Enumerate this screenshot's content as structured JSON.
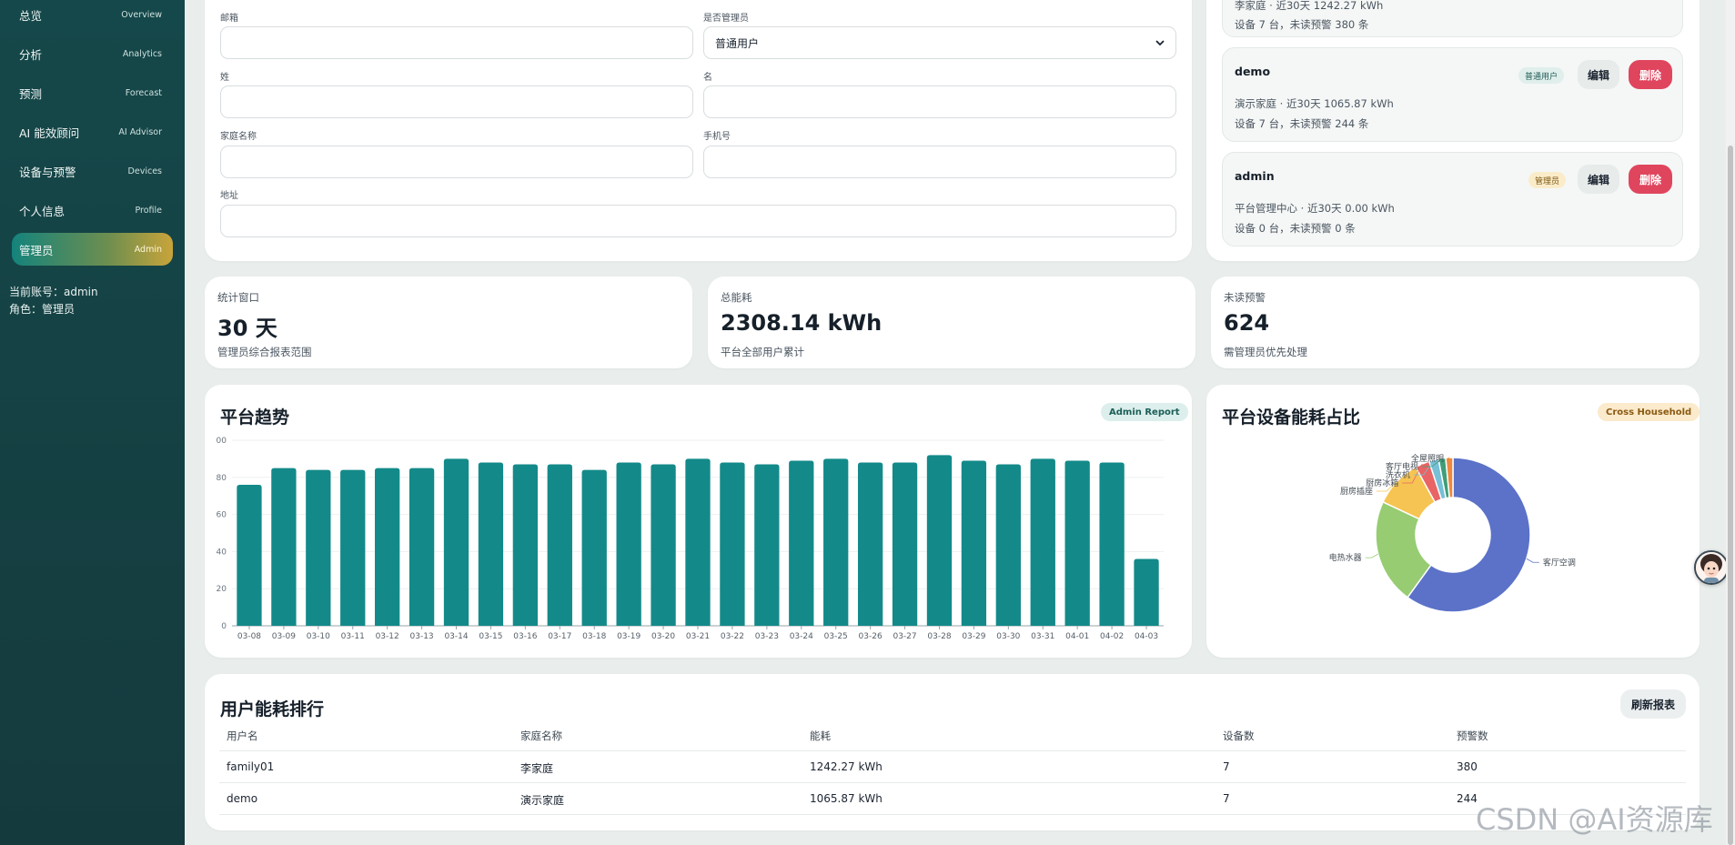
{
  "sidebar": {
    "items": [
      {
        "zh": "总览",
        "en": "Overview"
      },
      {
        "zh": "分析",
        "en": "Analytics"
      },
      {
        "zh": "预测",
        "en": "Forecast"
      },
      {
        "zh": "AI 能效顾问",
        "en": "AI Advisor"
      },
      {
        "zh": "设备与预警",
        "en": "Devices"
      },
      {
        "zh": "个人信息",
        "en": "Profile"
      },
      {
        "zh": "管理员",
        "en": "Admin"
      }
    ],
    "active_index": 6,
    "account_line": "当前账号：admin",
    "role_line": "角色：管理员"
  },
  "form": {
    "email_label": "邮箱",
    "is_admin_label": "是否管理员",
    "is_admin_value": "普通用户",
    "last_name_label": "姓",
    "first_name_label": "名",
    "household_label": "家庭名称",
    "phone_label": "手机号",
    "address_label": "地址"
  },
  "users": {
    "partial_line1": "李家庭 · 近30天 1242.27 kWh",
    "partial_line2": "设备 7 台，未读预警 380 条",
    "list": [
      {
        "name": "demo",
        "tag": "普通用户",
        "line1": "演示家庭 · 近30天 1065.87 kWh",
        "line2": "设备 7 台，未读预警 244 条"
      },
      {
        "name": "admin",
        "tag": "管理员",
        "line1": "平台管理中心 · 近30天 0.00 kWh",
        "line2": "设备 0 台，未读预警 0 条"
      }
    ],
    "edit_label": "编辑",
    "delete_label": "删除"
  },
  "stats": [
    {
      "label": "统计窗口",
      "value": "30 天",
      "note": "管理员综合报表范围"
    },
    {
      "label": "总能耗",
      "value": "2308.14 kWh",
      "note": "平台全部用户累计"
    },
    {
      "label": "未读预警",
      "value": "624",
      "note": "需管理员优先处理"
    }
  ],
  "trend": {
    "title": "平台趋势",
    "badge": "Admin Report"
  },
  "pie": {
    "title": "平台设备能耗占比",
    "badge": "Cross Household"
  },
  "ranking": {
    "title": "用户能耗排行",
    "refresh_label": "刷新报表",
    "headers": [
      "用户名",
      "家庭名称",
      "能耗",
      "设备数",
      "预警数"
    ],
    "rows": [
      [
        "family01",
        "李家庭",
        "1242.27 kWh",
        "7",
        "380"
      ],
      [
        "demo",
        "演示家庭",
        "1065.87 kWh",
        "7",
        "244"
      ]
    ]
  },
  "watermark": "CSDN @AI资源库",
  "colors": {
    "bar": "#138a89",
    "delete": "#e0455e",
    "accent": "#14837c"
  },
  "chart_data": [
    {
      "type": "bar",
      "categories": [
        "03-08",
        "03-09",
        "03-10",
        "03-11",
        "03-12",
        "03-13",
        "03-14",
        "03-15",
        "03-16",
        "03-17",
        "03-18",
        "03-19",
        "03-20",
        "03-21",
        "03-22",
        "03-23",
        "03-24",
        "03-25",
        "03-26",
        "03-27",
        "03-28",
        "03-29",
        "03-30",
        "03-31",
        "04-01",
        "04-02",
        "04-03"
      ],
      "values": [
        76,
        85,
        84,
        84,
        85,
        85,
        90,
        88,
        87,
        87,
        84,
        88,
        87,
        90,
        88,
        87,
        89,
        90,
        88,
        88,
        92,
        89,
        87,
        90,
        89,
        88,
        36
      ],
      "ylim": [
        0,
        100
      ],
      "yticks": [
        "0",
        "20",
        "40",
        "60",
        "80",
        "00"
      ],
      "grid": true
    },
    {
      "type": "pie",
      "donut": true,
      "labels": [
        "客厅空调",
        "电热水器",
        "厨房插座",
        "厨房冰箱",
        "洗衣机",
        "客厅电视",
        "全屋照明"
      ],
      "values": [
        60,
        22,
        10,
        3,
        2,
        1.5,
        1.5
      ],
      "colors": [
        "#5b72c8",
        "#97cc72",
        "#f6c452",
        "#e96464",
        "#78bfd8",
        "#3f9e78",
        "#f0883e"
      ]
    }
  ]
}
